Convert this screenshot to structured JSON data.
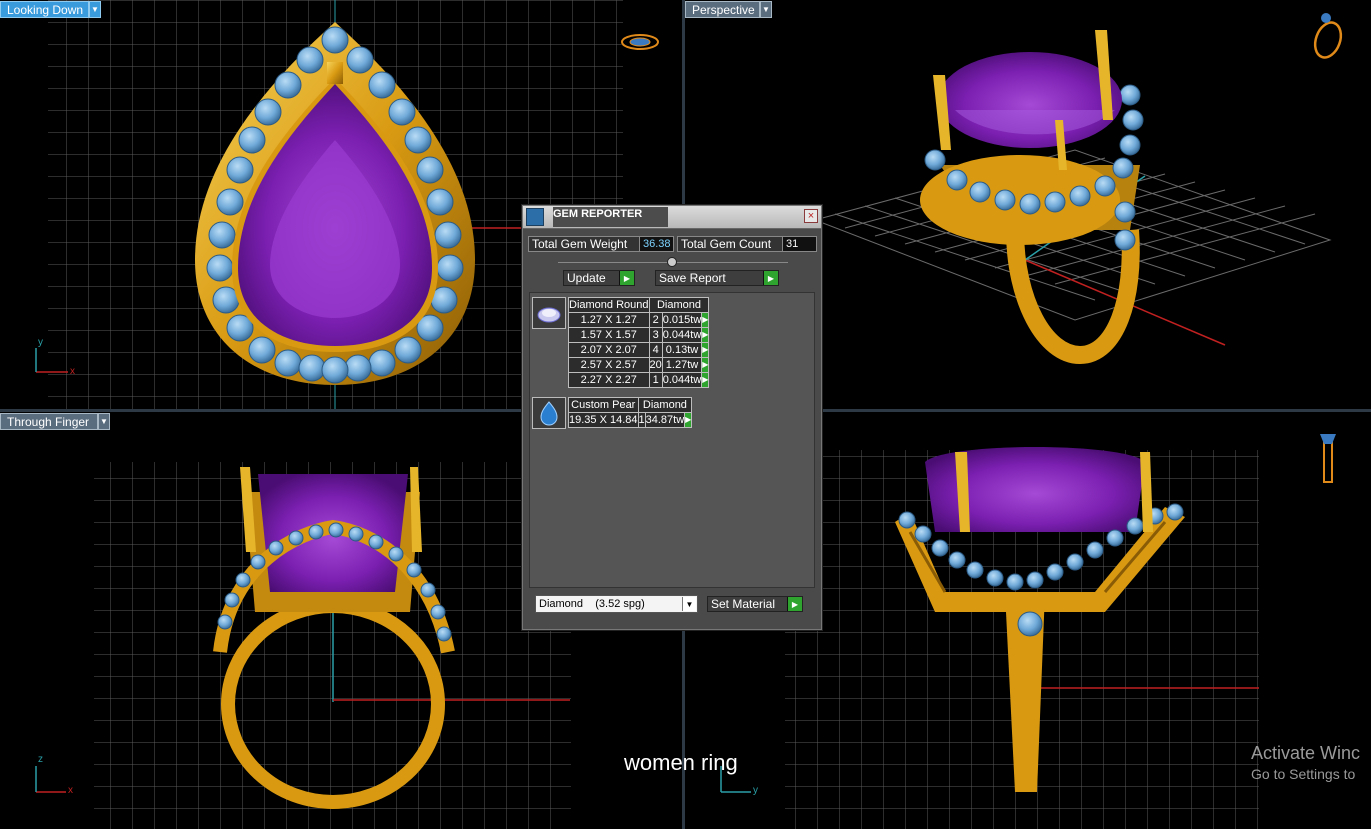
{
  "viewports": {
    "top_left": {
      "label": "Looking Down"
    },
    "top_right": {
      "label": "Perspective"
    },
    "bottom_left": {
      "label": "Through Finger"
    }
  },
  "axes": {
    "x": "x",
    "y": "y",
    "z": "z"
  },
  "gem_reporter": {
    "title": "GEM REPORTER",
    "close": "×",
    "total_weight_label": "Total Gem Weight",
    "total_weight_value": "36.38",
    "total_count_label": "Total Gem Count",
    "total_count_value": "31",
    "update_label": "Update",
    "save_report_label": "Save Report",
    "groups": [
      {
        "shape": "Diamond Round",
        "material": "Diamond",
        "rows": [
          {
            "size": "1.27 X 1.27",
            "count": "2",
            "weight": "0.015tw"
          },
          {
            "size": "1.57 X 1.57",
            "count": "3",
            "weight": "0.044tw"
          },
          {
            "size": "2.07 X 2.07",
            "count": "4",
            "weight": "0.13tw"
          },
          {
            "size": "2.57 X 2.57",
            "count": "20",
            "weight": "1.27tw"
          },
          {
            "size": "2.27 X 2.27",
            "count": "1",
            "weight": "0.044tw"
          }
        ]
      },
      {
        "shape": "Custom Pear",
        "material": "Diamond",
        "rows": [
          {
            "size": "19.35 X 14.84",
            "count": "1",
            "weight": "34.87tw"
          }
        ]
      }
    ],
    "material_select": "Diamond    (3.52 spg)",
    "set_material_label": "Set Material"
  },
  "caption": "women ring",
  "watermark": {
    "line1": "Activate Winc",
    "line2": "Go to Settings to"
  },
  "colors": {
    "gold": "#e0a81a",
    "amethyst": "#7a1fb0",
    "topaz": "#6fa9d8",
    "accent": "#3a9bdc"
  }
}
